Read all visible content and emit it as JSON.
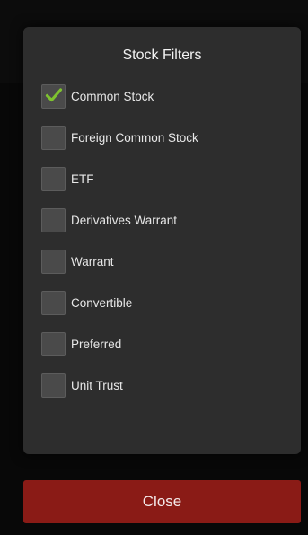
{
  "dialog": {
    "title": "Stock Filters",
    "filters": [
      {
        "label": "Common Stock",
        "checked": true
      },
      {
        "label": "Foreign Common Stock",
        "checked": false
      },
      {
        "label": "ETF",
        "checked": false
      },
      {
        "label": "Derivatives Warrant",
        "checked": false
      },
      {
        "label": "Warrant",
        "checked": false
      },
      {
        "label": "Convertible",
        "checked": false
      },
      {
        "label": "Preferred",
        "checked": false
      },
      {
        "label": "Unit Trust",
        "checked": false
      }
    ]
  },
  "close_button": {
    "label": "Close"
  },
  "colors": {
    "dialog_bg": "#2d2d2d",
    "checkbox_bg": "#4a4a4a",
    "check_green": "#7ec22f",
    "close_bg": "#8a1b16",
    "text": "#e8e8e8"
  },
  "icons": {
    "check": "check-icon"
  }
}
